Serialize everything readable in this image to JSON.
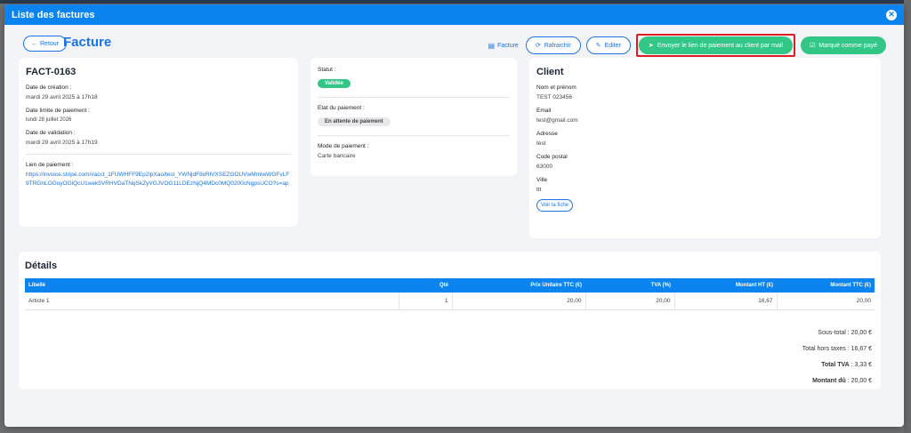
{
  "modal": {
    "title": "Liste des factures",
    "close_icon": "close-icon"
  },
  "toolbar": {
    "back_label": "Retour",
    "page_title": "Facture",
    "facture_link": "Facture",
    "refresh_label": "Rafraichir",
    "edit_label": "Editer",
    "send_label": "Envoyer le lien de paiement au client par mail",
    "paid_label": "Marqué comme payé"
  },
  "invoice": {
    "number": "FACT-0163",
    "creation_label": "Date de création :",
    "creation_value": "mardi 29 avril 2025 à 17h18",
    "due_label": "Date limite de paiement :",
    "due_value": "lundi 28 juillet 2026",
    "validation_label": "Date de validation :",
    "validation_value": "mardi 29 avril 2025 à 17h19",
    "link_label": "Lien de paiement :",
    "link_value": "https://invoice.stripe.com/i/acct_1FUWHFF9Ep2ipXao/test_YWNjdF8xRlVXSEZGOUVwMmlwWGFvLF9TRGhLOGoyOGlQcU1wek5VRHVDaTNqSkZyVGJVOG11LDEzNjQ4MDc0MQ0200cNgpsUCO?s=ap"
  },
  "status": {
    "statut_label": "Statut :",
    "statut_value": "Validée",
    "payment_state_label": "Etat du paiement :",
    "payment_state_value": "En attente de paiement",
    "payment_mode_label": "Mode de paiement :",
    "payment_mode_value": "Carte bancaire"
  },
  "client": {
    "title": "Client",
    "name_label": "Nom et prénom",
    "name_value": "TEST 023456",
    "email_label": "Email",
    "email_value": "test@gmail.com",
    "address_label": "Adresse",
    "address_value": "test",
    "postal_label": "Code postal",
    "postal_value": "63000",
    "city_label": "Ville",
    "city_value": "ttt",
    "fiche_button": "Voir la fiche"
  },
  "details": {
    "title": "Détails",
    "columns": [
      "Libellé",
      "Qté",
      "Prix Unitaire TTC (€)",
      "TVA (%)",
      "Montant HT (€)",
      "Montant TTC (€)"
    ],
    "rows": [
      [
        "Article 1",
        "1",
        "20,00",
        "20,00",
        "16,67",
        "20,00"
      ]
    ],
    "subtotal": "Sous-total : 20,00 €",
    "total_ht": "Total hors taxes : 16,67 €",
    "total_tva_label": "Total TVA",
    "total_tva_value": " : 3,33 €",
    "amount_due_label": "Montant dû",
    "amount_due_value": " : 20,00 €"
  },
  "colors": {
    "primary": "#0b84f0",
    "success": "#33c787",
    "highlight": "#e01b24"
  }
}
